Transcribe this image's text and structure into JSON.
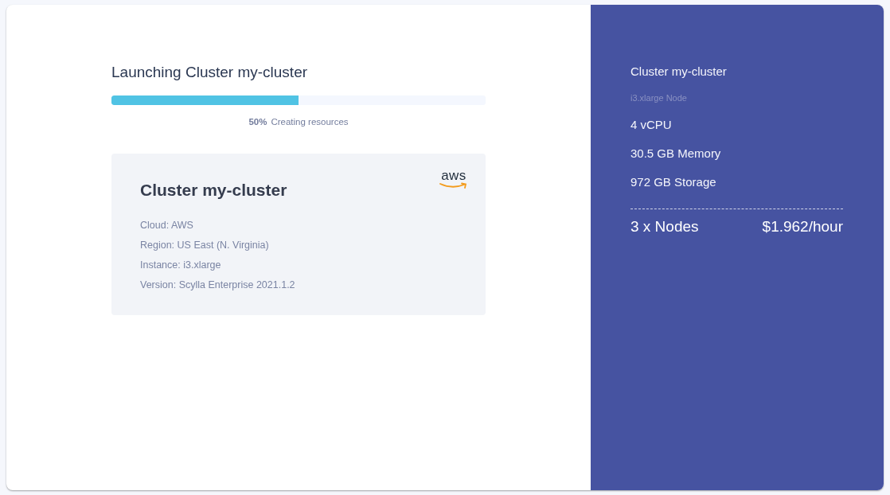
{
  "launch": {
    "title": "Launching Cluster my-cluster",
    "progress": {
      "level": 0.5,
      "percent": "50%",
      "status": "Creating resources"
    },
    "cluster_card": {
      "title": "Cluster my-cluster",
      "logo": "aws",
      "details": [
        "Cloud: AWS",
        "Region: US East (N. Virginia)",
        "Instance: i3.xlarge",
        "Version: Scylla Enterprise 2021.1.2"
      ]
    }
  },
  "summary": {
    "title": "Cluster my-cluster",
    "node_type": "i3.xlarge Node",
    "specs": [
      "4 vCPU",
      "30.5 GB Memory",
      "972 GB Storage"
    ],
    "total": {
      "nodes": "3 x Nodes",
      "price": "$1.962/hour"
    }
  }
}
